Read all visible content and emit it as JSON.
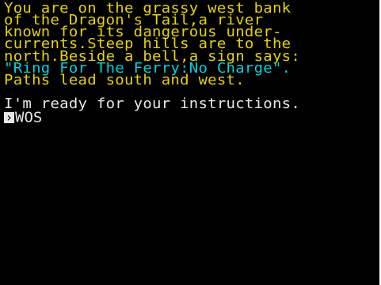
{
  "game": {
    "description": [
      "You are on the grassy west bank",
      "of the Dragon's Tail,a river",
      "known for its dangerous under-",
      "currents.Steep hills are to the",
      "north.Beside a bell,a sign says:"
    ],
    "sign_text": "\"Ring For The Ferry:No Charge\".",
    "paths_text": "Paths lead south and west.",
    "ready_message": "I'm ready for your instructions.",
    "prompt_symbol": "›",
    "command_input": "WOS"
  },
  "colors": {
    "background": "#000000",
    "description": "#e6d400",
    "sign": "#00d3df",
    "system": "#e7e7e7"
  }
}
